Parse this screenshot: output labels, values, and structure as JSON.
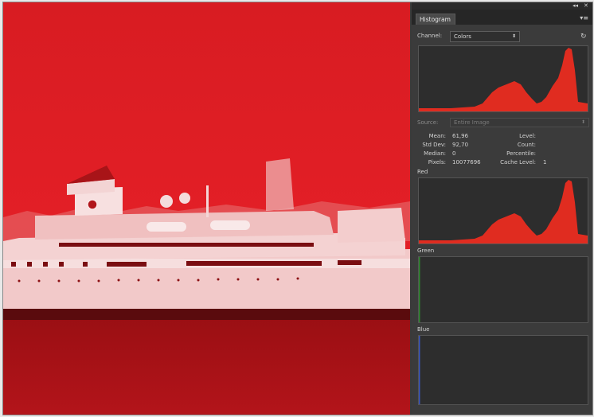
{
  "panel": {
    "title": "Histogram",
    "window_controls": {
      "collapse": "◂◂",
      "close": "✕"
    },
    "menu_icon": "panel-menu-icon",
    "refresh_icon": "refresh-icon",
    "channel": {
      "label": "Channel:",
      "value": "Colors"
    },
    "source": {
      "label": "Source:",
      "value": "Entire Image"
    },
    "stats": {
      "mean_label": "Mean:",
      "mean": "61,96",
      "stddev_label": "Std Dev:",
      "stddev": "92,70",
      "median_label": "Median:",
      "median": "0",
      "pixels_label": "Pixels:",
      "pixels": "10077696",
      "level_label": "Level:",
      "level": "",
      "count_label": "Count:",
      "count": "",
      "percentile_label": "Percentile:",
      "percentile": "",
      "cache_label": "Cache Level:",
      "cache": "1"
    },
    "channels": [
      {
        "name": "Red",
        "color": "#e02020"
      },
      {
        "name": "Green",
        "color": "#2e8a2e"
      },
      {
        "name": "Blue",
        "color": "#3a55c0"
      }
    ]
  },
  "colors": {
    "histogram_fill": "#e02c20",
    "photo_tint": "#d81c22"
  }
}
